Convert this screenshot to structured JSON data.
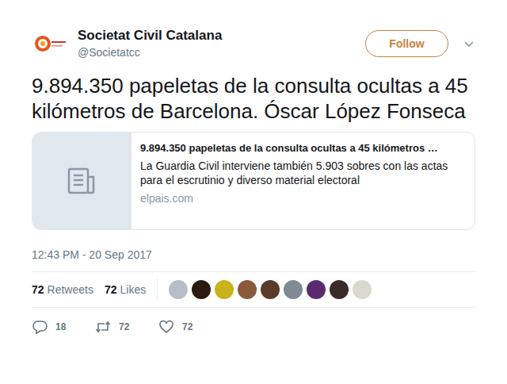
{
  "account": {
    "name": "Societat Civil Catalana",
    "handle": "@Societatcc"
  },
  "follow_button": {
    "label": "Follow"
  },
  "tweet": {
    "text": "9.894.350 papeletas de la consulta ocultas a 45 kilómetros de Barcelona. Óscar López Fonseca"
  },
  "link_card": {
    "title": "9.894.350 papeletas de la consulta ocultas a 45 kilómetros …",
    "description": "La Guardia Civil interviene también 5.903 sobres con las actas para el escrutinio y diverso material electoral",
    "domain": "elpais.com"
  },
  "timestamp": "12:43 PM - 20 Sep 2017",
  "stats": [
    {
      "count": "72",
      "label": "Retweets"
    },
    {
      "count": "72",
      "label": "Likes"
    }
  ],
  "liker_avatars": [
    {
      "color": "#b8bec8"
    },
    {
      "color": "#2a1a10"
    },
    {
      "color": "#c9b21a"
    },
    {
      "color": "#8a5a3c"
    },
    {
      "color": "#5a3a2a"
    },
    {
      "color": "#7f8a94"
    },
    {
      "color": "#5b2a6e"
    },
    {
      "color": "#3a2a2a"
    },
    {
      "color": "#d8d8cc"
    }
  ],
  "actions": [
    {
      "kind": "reply",
      "count": "18"
    },
    {
      "kind": "retweet",
      "count": "72"
    },
    {
      "kind": "like",
      "count": "72"
    }
  ]
}
